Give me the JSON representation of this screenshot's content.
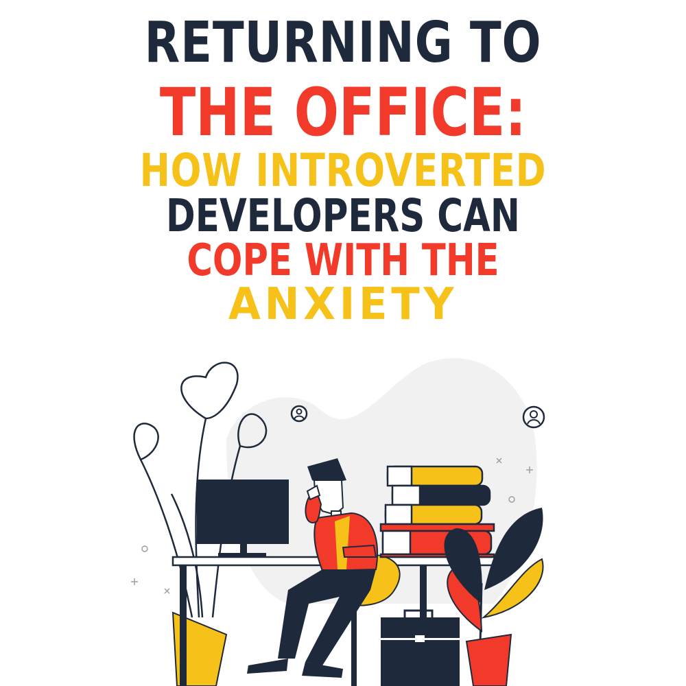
{
  "title": {
    "line1": "RETURNING TO",
    "line2": "THE OFFICE:",
    "line3": "HOW INTROVERTED",
    "line4": "DEVELOPERS CAN",
    "line5": "COPE WITH THE",
    "line6": "ANXIETY"
  },
  "colors": {
    "navy": "#1e2a3b",
    "red": "#f23a2a",
    "yellow": "#f6c21a",
    "blob": "#f1f1f1",
    "white": "#ffffff"
  },
  "icons": [
    "user-circle-icon",
    "user-circle-icon",
    "plant-icon",
    "monitor-icon",
    "book-stack-icon",
    "briefcase-icon",
    "plus-icon",
    "circle-icon",
    "cross-icon"
  ]
}
